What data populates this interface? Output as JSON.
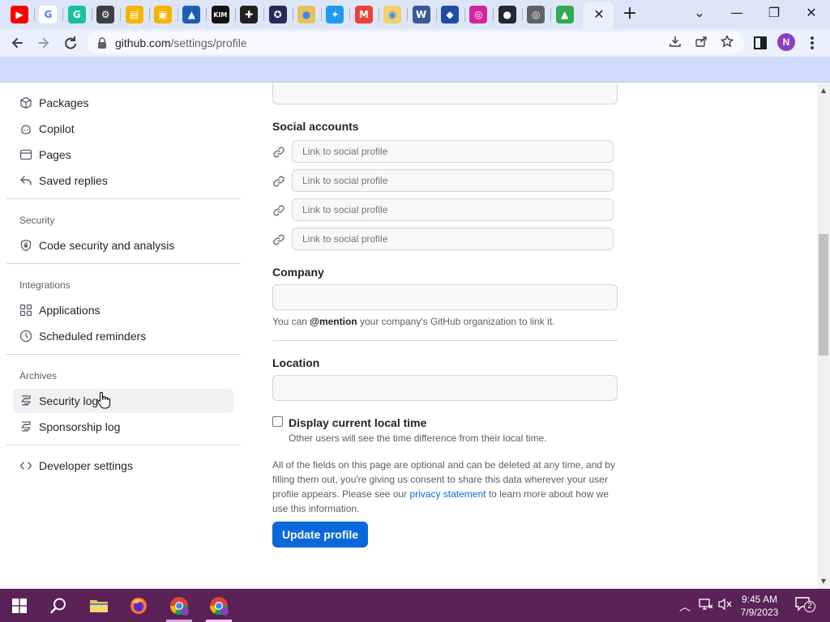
{
  "browser": {
    "tabs": [
      {
        "name": "youtube-tab-icon",
        "color": "#ff0000",
        "glyph": "▶"
      },
      {
        "name": "google-tab-icon",
        "color": "#ffffff",
        "glyph": "G"
      },
      {
        "name": "grammarly-tab-icon",
        "color": "#15c39a",
        "glyph": "G"
      },
      {
        "name": "settings-tab-icon",
        "color": "#3c4043",
        "glyph": "⚙"
      },
      {
        "name": "folder-tab-icon",
        "color": "#f4b400",
        "glyph": "▤"
      },
      {
        "name": "meet-tab-icon",
        "color": "#f4b400",
        "glyph": "▣"
      },
      {
        "name": "image-tab-icon",
        "color": "#1a5fb4",
        "glyph": "▲"
      },
      {
        "name": "kim-tab-icon",
        "color": "#111111",
        "glyph": "KIM"
      },
      {
        "name": "puzzle-tab-icon",
        "color": "#222222",
        "glyph": "✚"
      },
      {
        "name": "game-tab-icon",
        "color": "#2a2a5a",
        "glyph": "✪"
      },
      {
        "name": "coin-tab-icon",
        "color": "#e6c25a",
        "glyph": "●"
      },
      {
        "name": "twitter-tab-icon",
        "color": "#1d9bf0",
        "glyph": "✦"
      },
      {
        "name": "gmail-tab-icon",
        "color": "#ea4335",
        "glyph": "M"
      },
      {
        "name": "bulb-tab-icon",
        "color": "#f2d16b",
        "glyph": "◉"
      },
      {
        "name": "wiki-tab-icon",
        "color": "#3b5998",
        "glyph": "W"
      },
      {
        "name": "sonic-tab-icon",
        "color": "#1e4ba8",
        "glyph": "◆"
      },
      {
        "name": "instagram-tab-icon",
        "color": "#d6249f",
        "glyph": "◎"
      },
      {
        "name": "github-tab-icon",
        "color": "#24292f",
        "glyph": "●"
      },
      {
        "name": "chrome-tab-icon",
        "color": "#5f6368",
        "glyph": "◎"
      },
      {
        "name": "drive-tab-icon",
        "color": "#34a853",
        "glyph": "▲"
      }
    ],
    "close_glyph": "✕",
    "new_tab_glyph": "+",
    "window_minimize": "—",
    "window_restore": "❐",
    "window_close": "✕",
    "tab_search_glyph": "⌄",
    "url_host": "github.com",
    "url_path": "/settings/profile",
    "profile_initial": "N"
  },
  "sidebar": {
    "top_items": [
      {
        "label": "Packages",
        "icon": "package-icon"
      },
      {
        "label": "Copilot",
        "icon": "copilot-icon"
      },
      {
        "label": "Pages",
        "icon": "browser-icon"
      },
      {
        "label": "Saved replies",
        "icon": "reply-icon"
      }
    ],
    "security_heading": "Security",
    "security_items": [
      {
        "label": "Code security and analysis",
        "icon": "shield-lock-icon"
      }
    ],
    "integrations_heading": "Integrations",
    "integrations_items": [
      {
        "label": "Applications",
        "icon": "apps-icon"
      },
      {
        "label": "Scheduled reminders",
        "icon": "clock-icon"
      }
    ],
    "archives_heading": "Archives",
    "archives_items": [
      {
        "label": "Security log",
        "icon": "log-icon"
      },
      {
        "label": "Sponsorship log",
        "icon": "log-icon"
      }
    ],
    "developer_settings": "Developer settings"
  },
  "form": {
    "social_accounts_label": "Social accounts",
    "social_placeholder": "Link to social profile",
    "social_inputs": [
      "",
      "",
      "",
      ""
    ],
    "company_label": "Company",
    "company_value": "",
    "company_note_prefix": "You can ",
    "company_note_mention": "@mention",
    "company_note_suffix": " your company's GitHub organization to link it.",
    "location_label": "Location",
    "location_value": "",
    "local_time_label": "Display current local time",
    "local_time_checked": false,
    "local_time_note": "Other users will see the time difference from their local time.",
    "privacy_para_1": "All of the fields on this page are optional and can be deleted at any time, and by filling them out, you're giving us consent to share this data wherever your user profile appears. Please see our ",
    "privacy_link": "privacy statement",
    "privacy_para_2": " to learn more about how we use this information.",
    "update_button": "Update profile"
  },
  "taskbar": {
    "time": "9:45 AM",
    "date": "7/9/2023",
    "notification_count": "2"
  }
}
